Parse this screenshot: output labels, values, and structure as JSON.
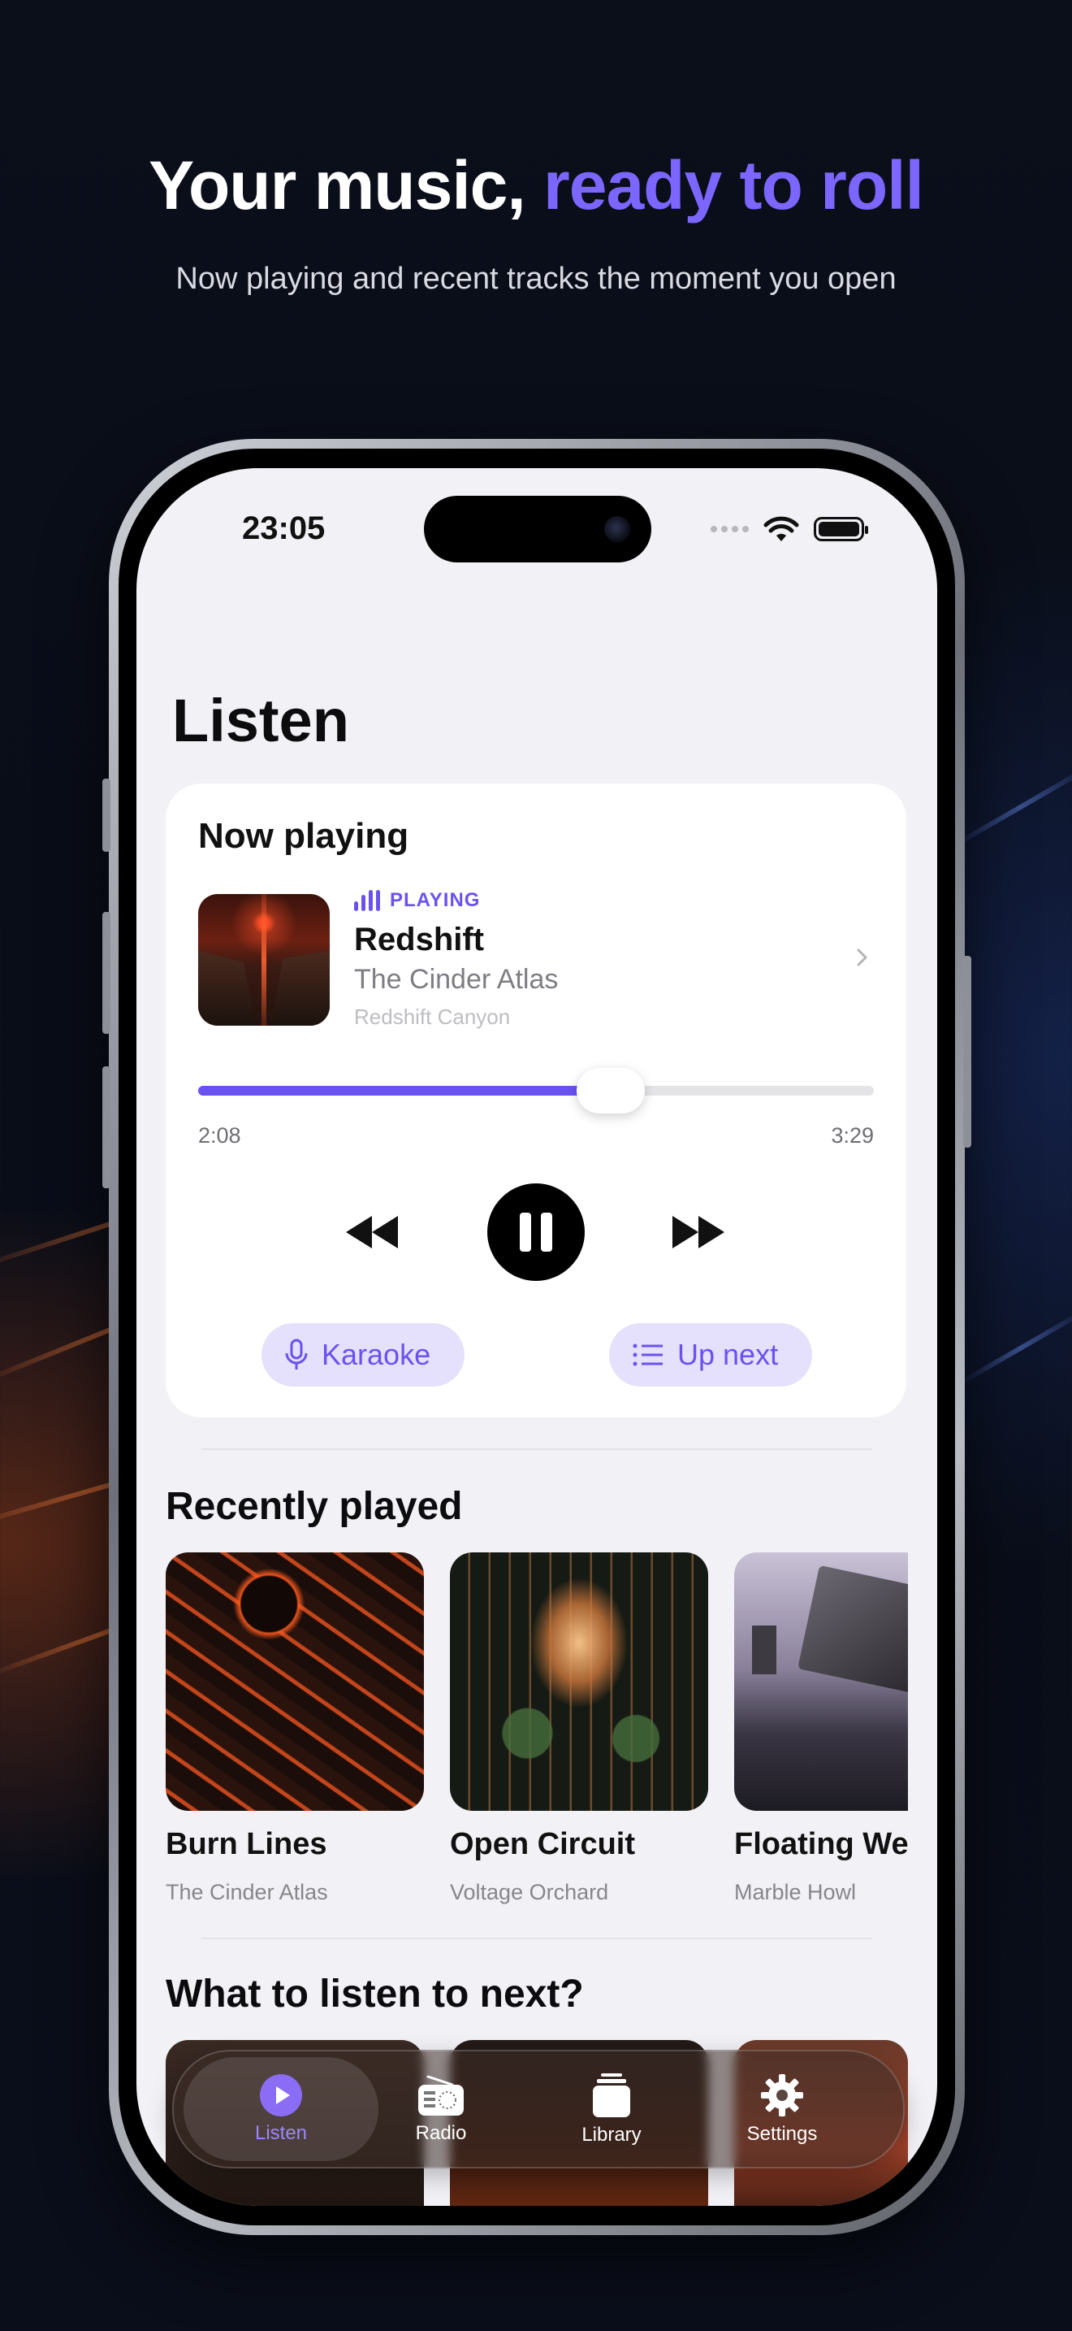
{
  "marketing": {
    "headline_part1": "Your music, ",
    "headline_accent": "ready to roll",
    "subheadline": "Now playing and recent tracks the moment you open"
  },
  "status_bar": {
    "time": "23:05"
  },
  "page": {
    "title": "Listen"
  },
  "now_playing": {
    "section_title": "Now playing",
    "state_label": "PLAYING",
    "track_title": "Redshift",
    "artist": "The Cinder Atlas",
    "album": "Redshift Canyon",
    "elapsed": "2:08",
    "duration": "3:29",
    "progress_fraction": 0.61,
    "karaoke_label": "Karaoke",
    "up_next_label": "Up next"
  },
  "recently_played": {
    "section_title": "Recently played",
    "items": [
      {
        "title": "Burn Lines",
        "artist": "The Cinder Atlas"
      },
      {
        "title": "Open Circuit",
        "artist": "Voltage Orchard"
      },
      {
        "title": "Floating Wei",
        "artist": "Marble Howl"
      }
    ]
  },
  "what_next": {
    "section_title": "What to listen to next?"
  },
  "tab_bar": {
    "tabs": [
      {
        "label": "Listen",
        "icon": "play-circle-icon",
        "active": true
      },
      {
        "label": "Radio",
        "icon": "radio-icon",
        "active": false
      },
      {
        "label": "Library",
        "icon": "library-icon",
        "active": false
      },
      {
        "label": "Settings",
        "icon": "gear-icon",
        "active": false
      }
    ]
  },
  "colors": {
    "accent": "#6a52f0",
    "headline_accent": "#7b66ff",
    "screen_background": "#f2f1f6",
    "card_background": "#ffffff"
  }
}
